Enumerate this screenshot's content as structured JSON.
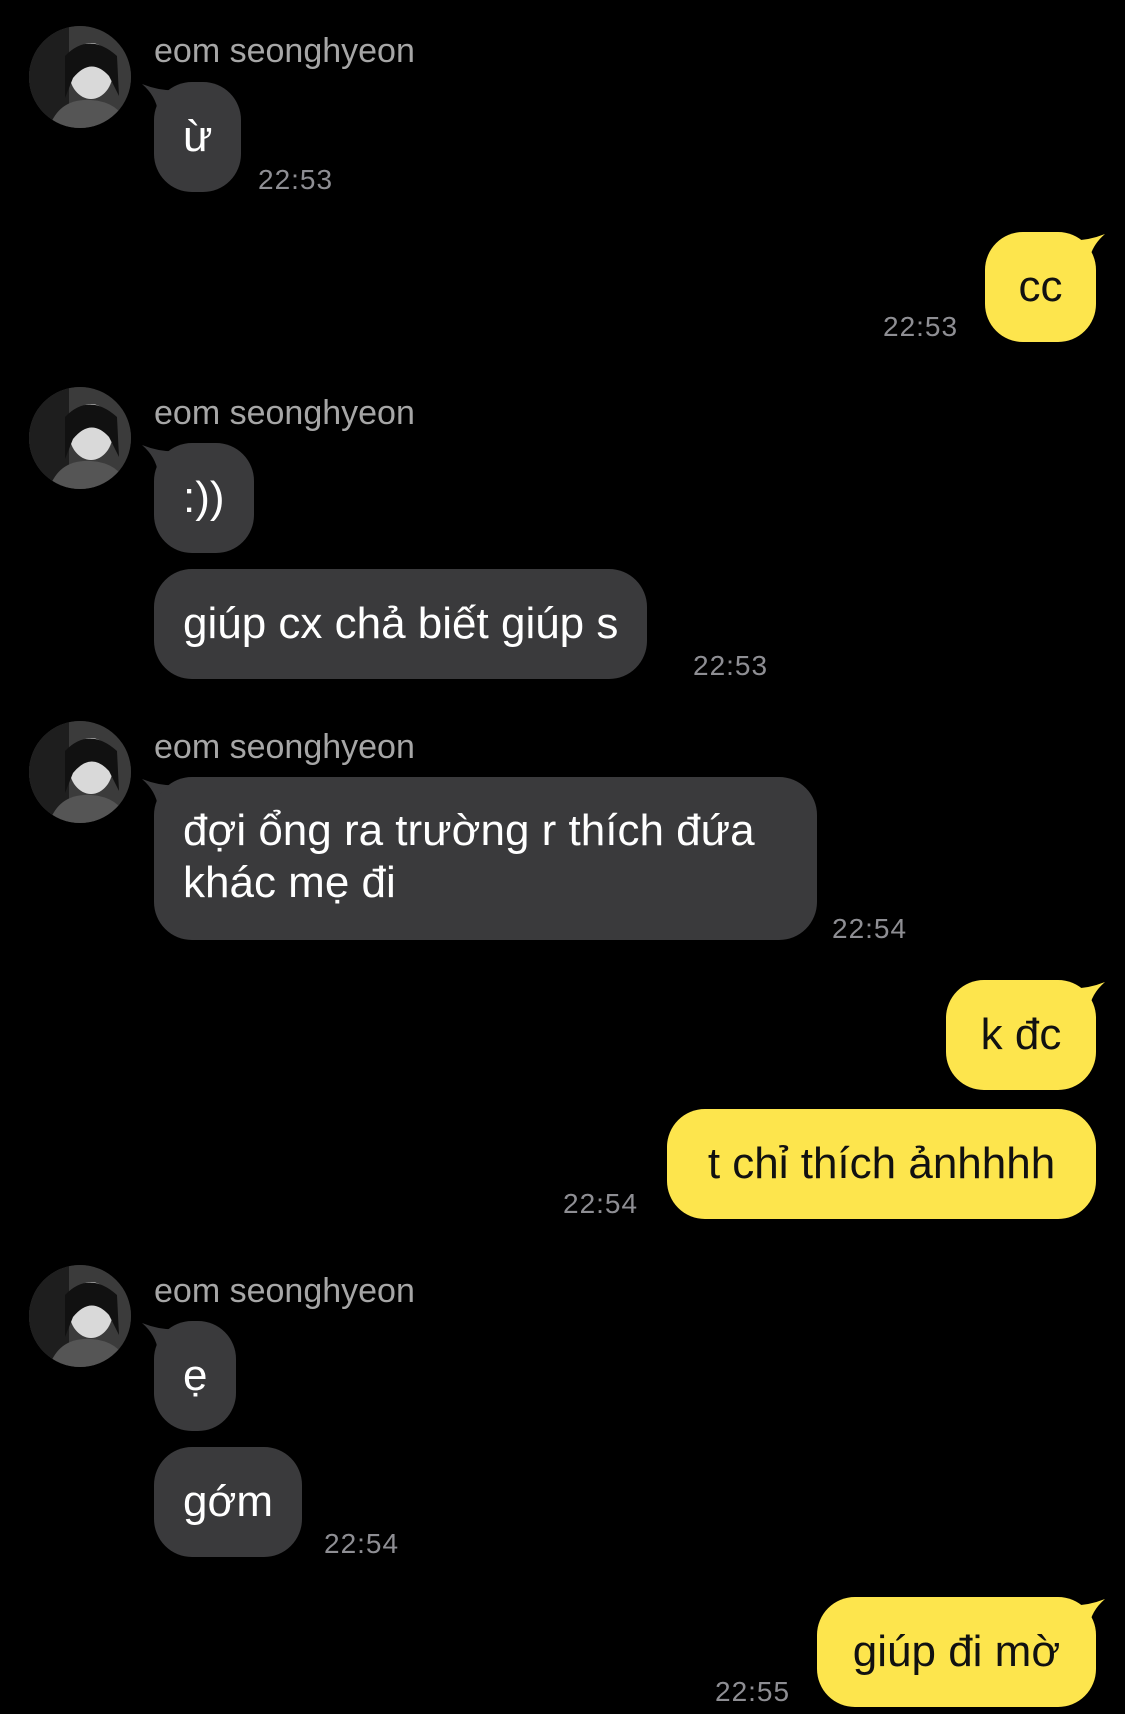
{
  "theme": {
    "background": "#000000",
    "incoming_bubble": "#3a3a3c",
    "outgoing_bubble": "#fde54d",
    "sender_name_color": "#a6a6a6",
    "time_color": "#8e8e93"
  },
  "messages": [
    {
      "sender": "eom seonghyeon",
      "avatar": "avatar-photo-icon",
      "text": "ừ",
      "time": "22:53"
    },
    {
      "text": "cc",
      "time": "22:53"
    },
    {
      "sender": "eom seonghyeon",
      "avatar": "avatar-photo-icon",
      "text": ":))"
    },
    {
      "text": "giúp cx chả biết giúp s",
      "time": "22:53"
    },
    {
      "sender": "eom seonghyeon",
      "avatar": "avatar-photo-icon",
      "text": "đợi ổng ra trường r thích đứa khác mẹ đi",
      "time": "22:54"
    },
    {
      "text": "k đc"
    },
    {
      "text": "t chỉ thích ảnhhhh",
      "time": "22:54"
    },
    {
      "sender": "eom seonghyeon",
      "avatar": "avatar-photo-icon",
      "text": "ẹ"
    },
    {
      "text": "gớm",
      "time": "22:54"
    },
    {
      "text": "giúp đi mờ",
      "time": "22:55"
    }
  ]
}
